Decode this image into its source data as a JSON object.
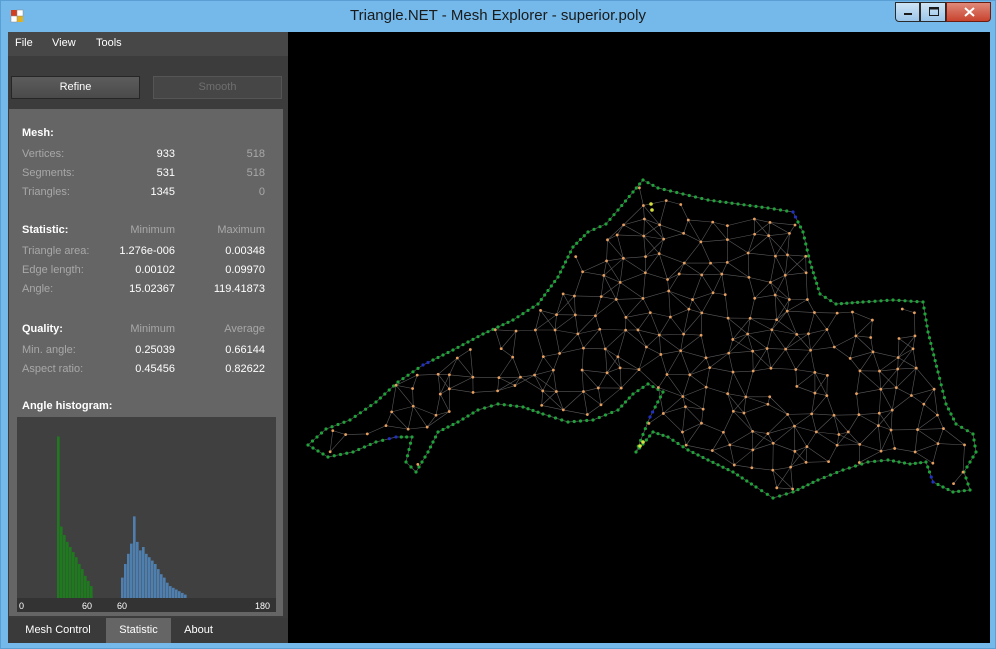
{
  "window": {
    "title": "Triangle.NET - Mesh Explorer - superior.poly"
  },
  "menu": {
    "file": "File",
    "view": "View",
    "tools": "Tools"
  },
  "toolbar": {
    "refine": "Refine",
    "smooth": "Smooth"
  },
  "mesh": {
    "header": "Mesh:",
    "rows": [
      {
        "label": "Vertices:",
        "value": "933",
        "value2": "518"
      },
      {
        "label": "Segments:",
        "value": "531",
        "value2": "518"
      },
      {
        "label": "Triangles:",
        "value": "1345",
        "value2": "0"
      }
    ]
  },
  "statistic": {
    "header": "Statistic:",
    "col1": "Minimum",
    "col2": "Maximum",
    "rows": [
      {
        "label": "Triangle area:",
        "min": "1.276e-006",
        "max": "0.00348"
      },
      {
        "label": "Edge length:",
        "min": "0.00102",
        "max": "0.09970"
      },
      {
        "label": "Angle:",
        "min": "15.02367",
        "max": "119.41873"
      }
    ]
  },
  "quality": {
    "header": "Quality:",
    "col1": "Minimum",
    "col2": "Average",
    "rows": [
      {
        "label": "Min. angle:",
        "min": "0.25039",
        "avg": "0.66144"
      },
      {
        "label": "Aspect ratio:",
        "min": "0.45456",
        "avg": "0.82622"
      }
    ]
  },
  "histogram": {
    "header": "Angle histogram:",
    "ticks": [
      "0",
      "60",
      "60",
      "180"
    ],
    "colors": {
      "min": "#1f7a1f",
      "max": "#4f7fae"
    },
    "min_angle_bins": [
      0.95,
      0.42,
      0.37,
      0.33,
      0.3,
      0.27,
      0.24,
      0.2,
      0.17,
      0.13,
      0.1,
      0.07
    ],
    "max_angle_bins": [
      0.12,
      0.2,
      0.26,
      0.32,
      0.48,
      0.33,
      0.28,
      0.3,
      0.26,
      0.24,
      0.22,
      0.2,
      0.17,
      0.14,
      0.12,
      0.09,
      0.07,
      0.06,
      0.05,
      0.04,
      0.03,
      0.02
    ]
  },
  "tabs": {
    "mesh_control": "Mesh Control",
    "statistic": "Statistic",
    "about": "About"
  },
  "mesh_render": {
    "boundary_color": "#1fa23a",
    "interior_color": "#e8a060",
    "edge_color": "#5a5a5a",
    "highlight_color": "#d8e040",
    "segment_color": "#2030c0"
  }
}
